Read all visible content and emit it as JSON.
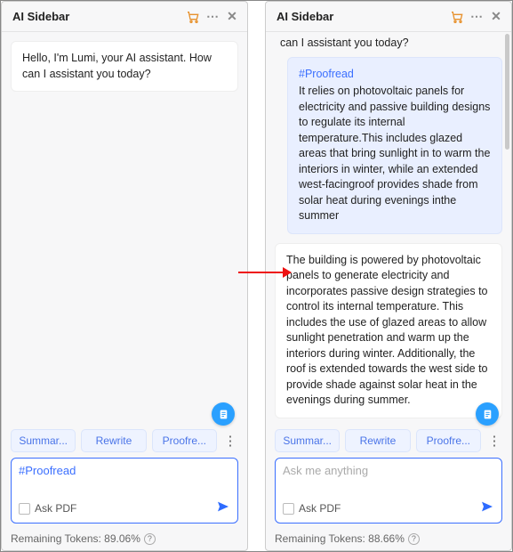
{
  "left": {
    "title": "AI Sidebar",
    "greeting": "Hello, I'm Lumi, your AI assistant. How can I assistant you today?",
    "chips": [
      "Summar...",
      "Rewrite",
      "Proofre..."
    ],
    "input_value": "#Proofread",
    "ask_pdf_label": "Ask PDF",
    "tokens_label": "Remaining Tokens: 89.06%"
  },
  "right": {
    "title": "AI Sidebar",
    "partial_greeting": "can I assistant you today?",
    "user_tag": "#Proofread",
    "user_text": "It relies on photovoltaic panels for electricity and passive building designs to regulate its internal temperature.This includes glazed areas that bring sunlight in to warm the interiors in winter, while an extended west-facingroof provides shade from solar heat during evenings inthe summer",
    "ai_text": "The building is powered by photovoltaic panels to generate electricity and incorporates passive design strategies to control its internal temperature. This includes the use of glazed areas to allow sunlight penetration and warm up the interiors during winter. Additionally, the roof is extended towards the west side to provide shade against solar heat in the evenings during summer.",
    "chips": [
      "Summar...",
      "Rewrite",
      "Proofre..."
    ],
    "input_placeholder": "Ask me anything",
    "ask_pdf_label": "Ask PDF",
    "tokens_label": "Remaining Tokens: 88.66%"
  }
}
